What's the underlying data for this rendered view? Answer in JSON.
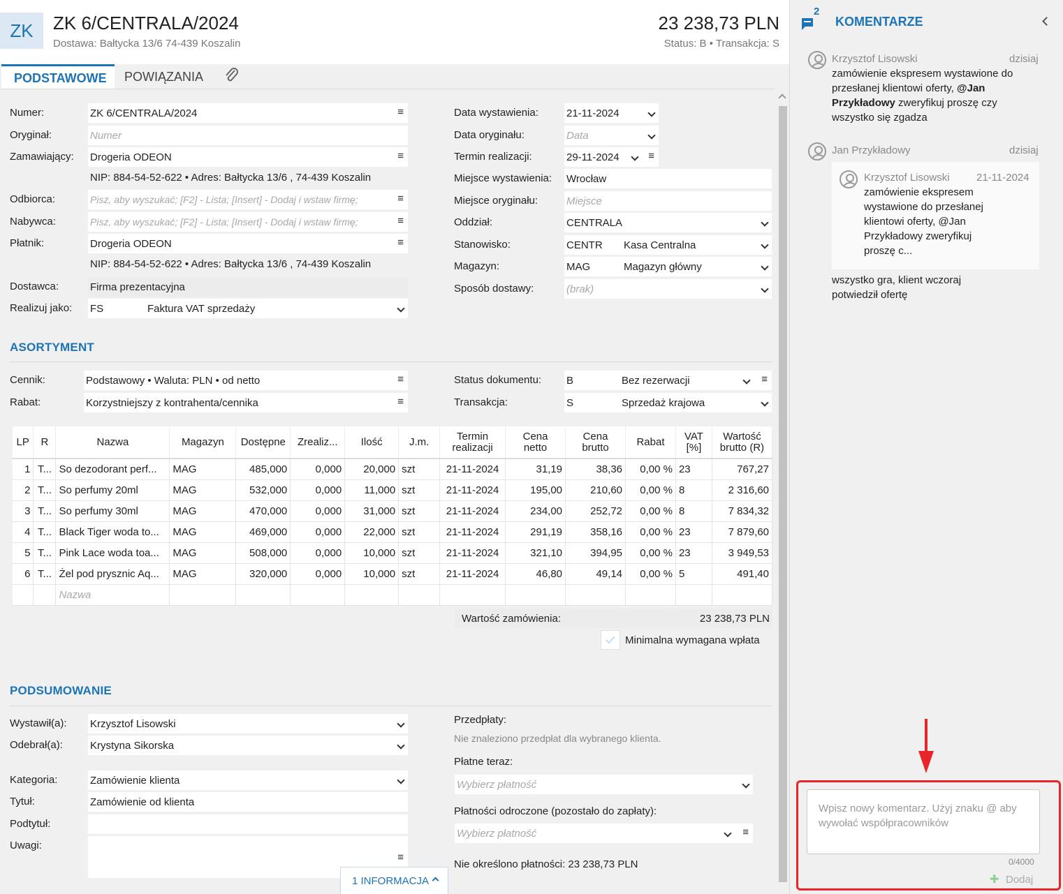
{
  "header": {
    "badge": "ZK",
    "title": "ZK 6/CENTRALA/2024",
    "subtitle": "Dostawa: Bałtycka  13/6  74-439 Koszalin",
    "amount": "23 238,73 PLN",
    "status": "Status:  B  •  Transakcja:  S"
  },
  "tabs": [
    {
      "label": "PODSTAWOWE",
      "active": true
    },
    {
      "label": "POWIĄZANIA",
      "active": false
    }
  ],
  "left_fields": {
    "numer_label": "Numer:",
    "numer_value": "ZK 6/CENTRALA/2024",
    "oryginal_label": "Oryginał:",
    "oryginal_ph": "Numer",
    "zamawiajacy_label": "Zamawiający:",
    "zamawiajacy_value": "Drogeria ODEON",
    "zamawiajacy_info": "NIP:  884-54-52-622  •  Adres:  Bałtycka  13/6 ,  74-439 Koszalin",
    "odbiorca_label": "Odbiorca:",
    "odbiorca_ph": "Pisz, aby wyszukać; [F2] - Lista; [Insert] - Dodaj i wstaw firmę;",
    "nabywca_label": "Nabywca:",
    "nabywca_ph": "Pisz, aby wyszukać; [F2] - Lista; [Insert] - Dodaj i wstaw firmę;",
    "platnik_label": "Płatnik:",
    "platnik_value": "Drogeria ODEON",
    "platnik_info": "NIP:  884-54-52-622  •  Adres:  Bałtycka  13/6 ,  74-439 Koszalin",
    "dostawca_label": "Dostawca:",
    "dostawca_value": "Firma prezentacyjna",
    "realizuj_label": "Realizuj jako:",
    "realizuj_code": "FS",
    "realizuj_value": "Faktura VAT sprzedaży"
  },
  "right_fields": {
    "data_wyst_label": "Data wystawienia:",
    "data_wyst_value": "21-11-2024",
    "data_oryg_label": "Data oryginału:",
    "data_oryg_ph": "Data",
    "termin_label": "Termin realizacji:",
    "termin_value": "29-11-2024",
    "miejsce_wyst_label": "Miejsce wystawienia:",
    "miejsce_wyst_value": "Wrocław",
    "miejsce_oryg_label": "Miejsce oryginału:",
    "miejsce_oryg_ph": "Miejsce",
    "oddzial_label": "Oddział:",
    "oddzial_value": "CENTRALA",
    "stanowisko_label": "Stanowisko:",
    "stanowisko_code": "CENTR",
    "stanowisko_value": "Kasa Centralna",
    "magazyn_label": "Magazyn:",
    "magazyn_code": "MAG",
    "magazyn_value": "Magazyn główny",
    "sposob_label": "Sposób dostawy:",
    "sposob_ph": "(brak)"
  },
  "asortyment": {
    "title": "ASORTYMENT",
    "cennik_label": "Cennik:",
    "cennik_value": "Podstawowy • Waluta: PLN • od netto",
    "rabat_label": "Rabat:",
    "rabat_value": "Korzystniejszy z kontrahenta/cennika",
    "status_label": "Status dokumentu:",
    "status_code": "B",
    "status_value": "Bez rezerwacji",
    "transakcja_label": "Transakcja:",
    "transakcja_code": "S",
    "transakcja_value": "Sprzedaż krajowa"
  },
  "table": {
    "headers": [
      "LP",
      "R",
      "Nazwa",
      "Magazyn",
      "Dostępne",
      "Zrealiz...",
      "Ilość",
      "J.m.",
      "Termin realizacji",
      "Cena netto",
      "Cena brutto",
      "Rabat",
      "VAT [%]",
      "Wartość brutto (R)"
    ],
    "rows": [
      [
        "1",
        "T...",
        "So dezodorant perf...",
        "MAG",
        "485,000",
        "0,000",
        "20,000",
        "szt",
        "21-11-2024",
        "31,19",
        "38,36",
        "0,00 %",
        "23",
        "767,27"
      ],
      [
        "2",
        "T...",
        "So perfumy 20ml",
        "MAG",
        "532,000",
        "0,000",
        "11,000",
        "szt",
        "21-11-2024",
        "195,00",
        "210,60",
        "0,00 %",
        "8",
        "2 316,60"
      ],
      [
        "3",
        "T...",
        "So perfumy 30ml",
        "MAG",
        "470,000",
        "0,000",
        "31,000",
        "szt",
        "21-11-2024",
        "234,00",
        "252,72",
        "0,00 %",
        "8",
        "7 834,32"
      ],
      [
        "4",
        "T...",
        "Black Tiger woda to...",
        "MAG",
        "469,000",
        "0,000",
        "22,000",
        "szt",
        "21-11-2024",
        "291,19",
        "358,16",
        "0,00 %",
        "23",
        "7 879,60"
      ],
      [
        "5",
        "T...",
        "Pink Lace woda toa...",
        "MAG",
        "508,000",
        "0,000",
        "10,000",
        "szt",
        "21-11-2024",
        "321,10",
        "394,95",
        "0,00 %",
        "23",
        "3 949,53"
      ],
      [
        "6",
        "T...",
        "Żel pod prysznic Aq...",
        "MAG",
        "320,000",
        "0,000",
        "10,000",
        "szt",
        "21-11-2024",
        "46,80",
        "49,14",
        "0,00 %",
        "5",
        "491,40"
      ]
    ],
    "new_row_ph": "Nazwa",
    "total_label": "Wartość zamówienia:",
    "total_value": "23 238,73 PLN",
    "min_payment_label": "Minimalna wymagana wpłata"
  },
  "podsumowanie": {
    "title": "PODSUMOWANIE",
    "wystawil_label": "Wystawił(a):",
    "wystawil_value": "Krzysztof Lisowski",
    "odebral_label": "Odebrał(a):",
    "odebral_value": "Krystyna Sikorska",
    "kategoria_label": "Kategoria:",
    "kategoria_value": "Zamówienie klienta",
    "tytul_label": "Tytuł:",
    "tytul_value": "Zamówienie od klienta",
    "podtytul_label": "Podtytuł:",
    "uwagi_label": "Uwagi:",
    "przedplaty_label": "Przedpłaty:",
    "przedplaty_info": "Nie znaleziono przedpłat dla wybranego klienta.",
    "platne_label": "Płatne teraz:",
    "platne_ph": "Wybierz płatność",
    "odroczone_label": "Płatności odroczone (pozostało do zapłaty):",
    "odroczone_ph": "Wybierz płatność",
    "nieokreslono": "Nie określono płatności: 23 238,73 PLN",
    "info_button": "1 INFORMACJA"
  },
  "comments": {
    "title": "KOMENTARZE",
    "count": "2",
    "items": [
      {
        "author": "Krzysztof Lisowski",
        "date": "dzisiaj"
      },
      {
        "author": "Jan Przykładowy",
        "date": "dzisiaj"
      }
    ],
    "c1_text_a": "zamówienie ekspresem wystawione do przesłanej klientowi oferty, ",
    "c1_mention": "@Jan Przykładowy",
    "c1_text_b": " zweryfikuj proszę czy wszystko się zgadza",
    "quote_author": "Krzysztof Lisowski",
    "quote_date": "21-11-2024",
    "quote_text": "zamówienie ekspresem wystawione do przesłanej klientowi oferty, @Jan Przykładowy zweryfikuj proszę c...",
    "c2_text": "wszystko gra, klient wczoraj potwiedził ofertę",
    "input_ph": "Wpisz nowy komentarz. Użyj znaku @ aby wywołać współpracowników",
    "counter": "0/4000",
    "add_button": "Dodaj"
  },
  "colors": {
    "accent": "#1d74b7",
    "highlight": "#e8262a"
  }
}
